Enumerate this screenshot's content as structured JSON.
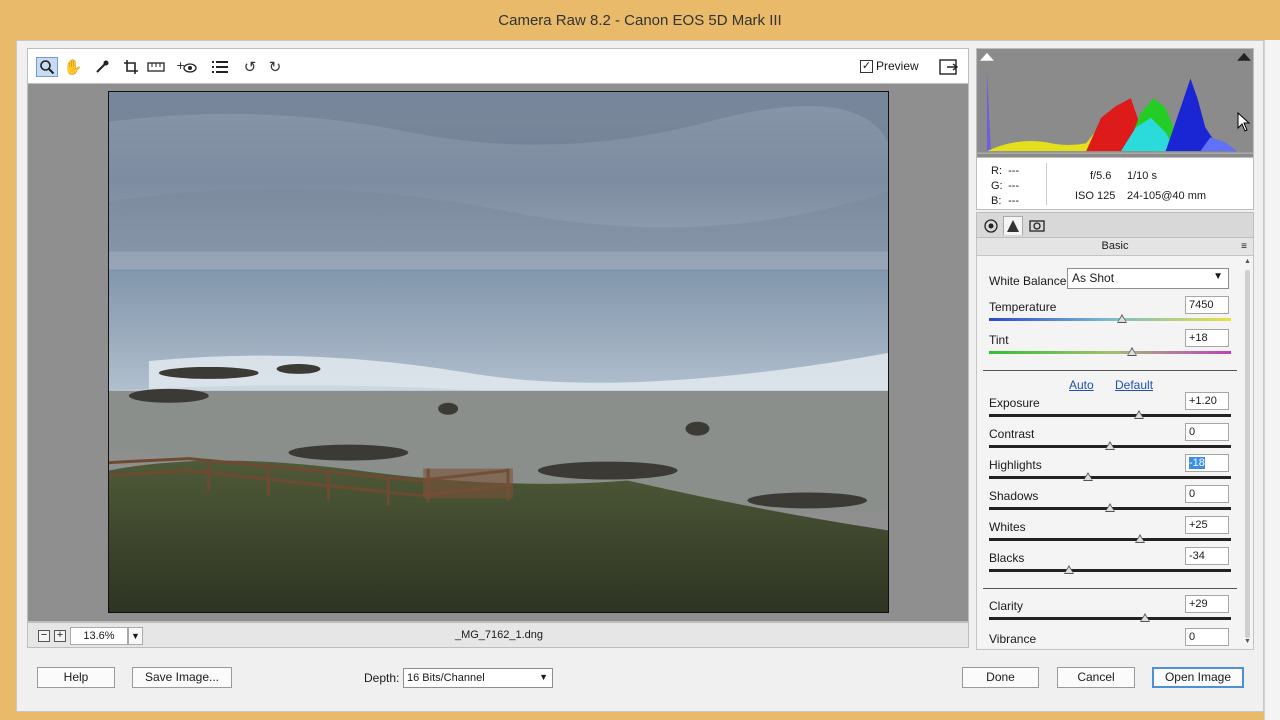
{
  "window": {
    "title": "Camera Raw 8.2  -  Canon EOS 5D Mark III"
  },
  "toolbar": {
    "tools": [
      "zoom-icon",
      "hand-icon",
      "white-balance-icon",
      "crop-icon",
      "straighten-icon",
      "red-eye-icon",
      "presets-icon",
      "rotate-ccw-icon",
      "rotate-cw-icon"
    ],
    "preview_label": "Preview",
    "preview_checked": true
  },
  "status": {
    "zoom_out": "−",
    "zoom_in": "+",
    "zoom_value": "13.6%",
    "filename": "_MG_7162_1.dng"
  },
  "info": {
    "r_label": "R:",
    "r_value": "---",
    "g_label": "G:",
    "g_value": "---",
    "b_label": "B:",
    "b_value": "---",
    "aperture": "f/5.6",
    "shutter": "1/10 s",
    "iso": "ISO 125",
    "lens": "24-105@40 mm"
  },
  "panel": {
    "title": "Basic",
    "white_balance_label": "White Balance:",
    "white_balance_value": "As Shot",
    "auto_link": "Auto",
    "default_link": "Default",
    "sliders": [
      {
        "label": "Temperature",
        "value": "7450",
        "pos": 0.55
      },
      {
        "label": "Tint",
        "value": "+18",
        "pos": 0.59
      },
      {
        "label": "Exposure",
        "value": "+1.20",
        "pos": 0.62
      },
      {
        "label": "Contrast",
        "value": "0",
        "pos": 0.5
      },
      {
        "label": "Highlights",
        "value": "-18",
        "pos": 0.41
      },
      {
        "label": "Shadows",
        "value": "0",
        "pos": 0.5
      },
      {
        "label": "Whites",
        "value": "+25",
        "pos": 0.625
      },
      {
        "label": "Blacks",
        "value": "-34",
        "pos": 0.33
      },
      {
        "label": "Clarity",
        "value": "+29",
        "pos": 0.645
      },
      {
        "label": "Vibrance",
        "value": "0",
        "pos": 0.5
      }
    ]
  },
  "footer": {
    "help": "Help",
    "save_image": "Save Image...",
    "depth_label": "Depth:",
    "depth_value": "16 Bits/Channel",
    "done": "Done",
    "cancel": "Cancel",
    "open_image": "Open Image"
  }
}
